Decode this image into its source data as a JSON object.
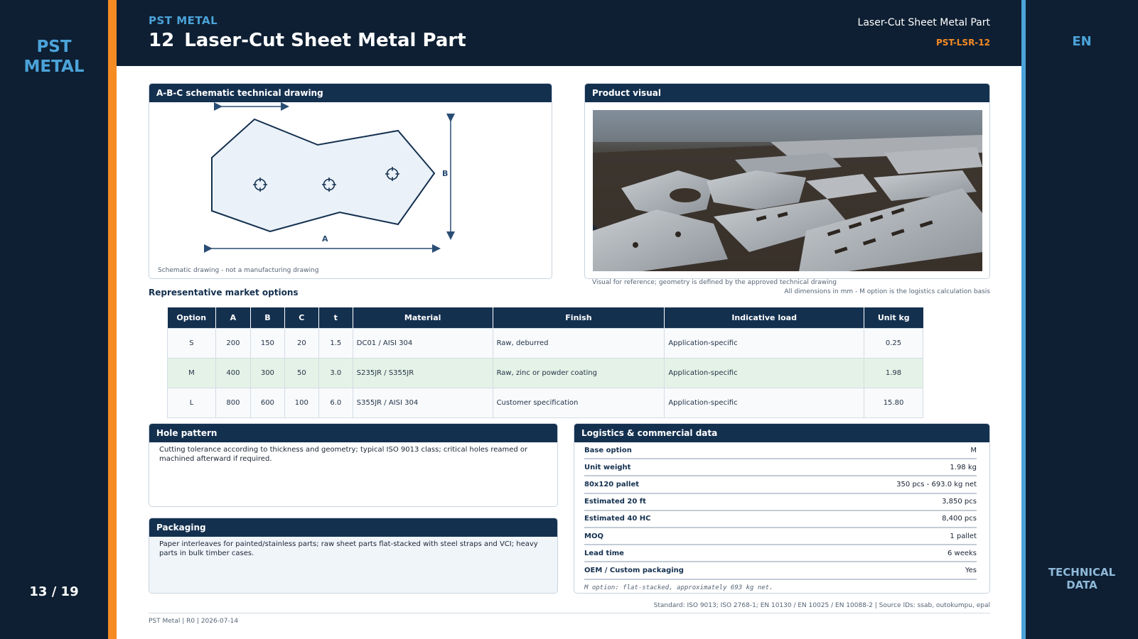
{
  "side": {
    "brand_line1": "PST",
    "brand_line2": "METAL",
    "page_counter": "13 / 19",
    "language": "EN",
    "section_line1": "TECHNICAL",
    "section_line2": "DATA"
  },
  "header": {
    "brand": "PST METAL",
    "number": "12",
    "title": "Laser-Cut Sheet Metal Part",
    "doc_name": "Laser-Cut Sheet Metal Part",
    "doc_code": "PST-LSR-12"
  },
  "colors": {
    "navy": "#0e1f33",
    "panel_header": "#14304f",
    "orange_accent": "#f68b24",
    "blue_accent": "#4ba3d9",
    "highlight_row": "#e5f2e7"
  },
  "drawing": {
    "title": "A-B-C schematic technical drawing",
    "label_a": "A",
    "label_b": "B",
    "note": "Schematic drawing - not a manufacturing drawing"
  },
  "visual": {
    "title": "Product visual",
    "note": "Visual for reference; geometry is defined by the approved technical drawing"
  },
  "dimensions_note": "All dimensions in mm - M option is the logistics calculation basis",
  "options_section_title": "Representative market options",
  "options_table": {
    "headers": [
      "Option",
      "A",
      "B",
      "C",
      "t",
      "Material",
      "Finish",
      "Indicative load",
      "Unit kg"
    ],
    "rows": [
      [
        "S",
        "200",
        "150",
        "20",
        "1.5",
        "DC01 / AISI 304",
        "Raw, deburred",
        "Application-specific",
        "0.25"
      ],
      [
        "M",
        "400",
        "300",
        "50",
        "3.0",
        "S235JR / S355JR",
        "Raw, zinc or powder coating",
        "Application-specific",
        "1.98"
      ],
      [
        "L",
        "800",
        "600",
        "100",
        "6.0",
        "S355JR / AISI 304",
        "Customer specification",
        "Application-specific",
        "15.80"
      ]
    ]
  },
  "hole_pattern": {
    "title": "Hole pattern",
    "text": "Cutting tolerance according to thickness and geometry; typical ISO 9013 class; critical holes reamed or machined afterward if required."
  },
  "packaging": {
    "title": "Packaging",
    "text": "Paper interleaves for painted/stainless parts; raw sheet parts flat-stacked with steel straps and VCI; heavy parts in bulk timber cases."
  },
  "logistics": {
    "title": "Logistics & commercial data",
    "rows": [
      {
        "key": "Base option",
        "value": "M"
      },
      {
        "key": "Unit weight",
        "value": "1.98 kg"
      },
      {
        "key": "80x120 pallet",
        "value": "350 pcs - 693.0 kg net"
      },
      {
        "key": "Estimated 20 ft",
        "value": "3,850 pcs"
      },
      {
        "key": "Estimated 40 HC",
        "value": "8,400 pcs"
      },
      {
        "key": "MOQ",
        "value": "1 pallet"
      },
      {
        "key": "Lead time",
        "value": "6 weeks"
      },
      {
        "key": "OEM / Custom packaging",
        "value": "Yes"
      }
    ],
    "note": "M option: flat-stacked, approximately 693 kg net."
  },
  "standards": "Standard: ISO 9013; ISO 2768-1; EN 10130 / EN 10025 / EN 10088-2 | Source IDs: ssab, outokumpu, epal",
  "footer": "PST Metal | R0 | 2026-07-14"
}
